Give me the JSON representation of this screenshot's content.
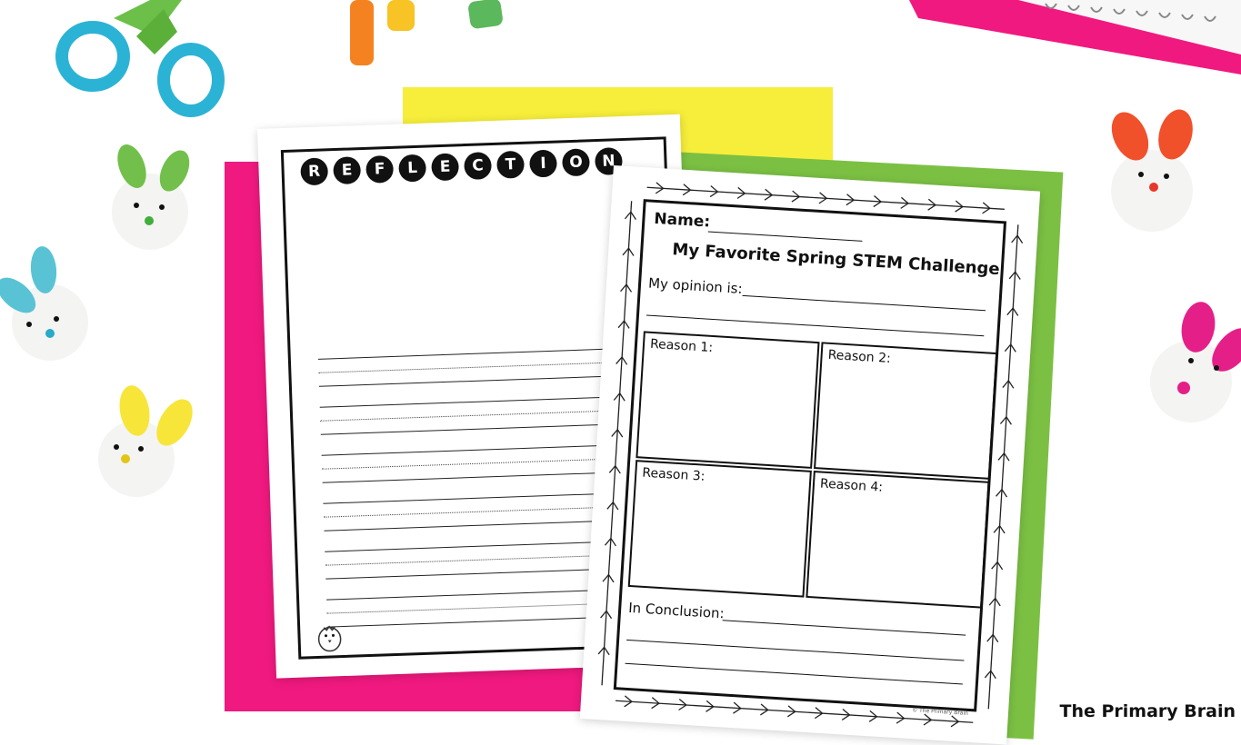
{
  "reflection": {
    "letters": [
      "R",
      "E",
      "F",
      "L",
      "E",
      "C",
      "T",
      "I",
      "O",
      "N"
    ]
  },
  "worksheet": {
    "name_label": "Name:",
    "title": "My Favorite Spring STEM Challenge",
    "opinion_label": "My opinion is:",
    "reasons": [
      "Reason 1:",
      "Reason 2:",
      "Reason 3:",
      "Reason 4:"
    ],
    "conclusion_label": "In Conclusion:",
    "footer_credit": "© The Primary Brain"
  },
  "brand": "The Primary Brain",
  "colors": {
    "pink_paper": "#f0197f",
    "yellow_paper": "#f6ee3a",
    "green_paper": "#7bc043",
    "scissors_blue": "#2bb3d6",
    "scissors_green": "#6cc04a"
  }
}
